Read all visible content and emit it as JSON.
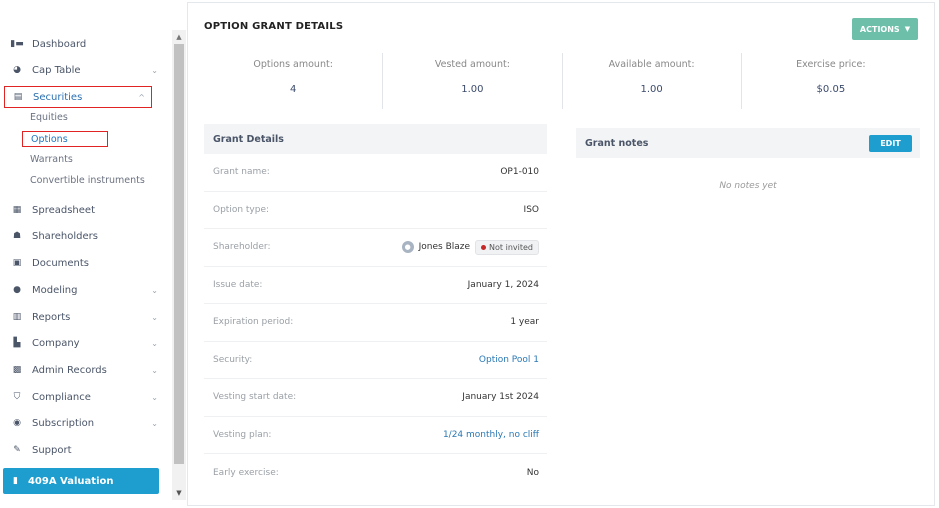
{
  "sidebar": {
    "items": [
      {
        "label": "Dashboard",
        "icon": "dashboard-icon",
        "chevron": ""
      },
      {
        "label": "Cap Table",
        "icon": "pie-chart-icon",
        "chevron": "⌄"
      },
      {
        "label": "Securities",
        "icon": "clipboard-icon",
        "chevron": "^"
      },
      {
        "label": "Spreadsheet",
        "icon": "spreadsheet-icon",
        "chevron": ""
      },
      {
        "label": "Shareholders",
        "icon": "person-icon",
        "chevron": ""
      },
      {
        "label": "Documents",
        "icon": "document-icon",
        "chevron": ""
      },
      {
        "label": "Modeling",
        "icon": "lightbulb-icon",
        "chevron": "⌄"
      },
      {
        "label": "Reports",
        "icon": "report-icon",
        "chevron": "⌄"
      },
      {
        "label": "Company",
        "icon": "company-icon",
        "chevron": "⌄"
      },
      {
        "label": "Admin Records",
        "icon": "records-icon",
        "chevron": "⌄"
      },
      {
        "label": "Compliance",
        "icon": "shield-icon",
        "chevron": "⌄"
      },
      {
        "label": "Subscription",
        "icon": "dollar-icon",
        "chevron": "⌄"
      },
      {
        "label": "Support",
        "icon": "support-icon",
        "chevron": ""
      }
    ],
    "securities_sub": [
      "Equities",
      "Options",
      "Warrants",
      "Convertible instruments"
    ],
    "valuation_button": "409A Valuation"
  },
  "main": {
    "title": "OPTION GRANT DETAILS",
    "actions_label": "ACTIONS",
    "stats": [
      {
        "label": "Options amount:",
        "value": "4"
      },
      {
        "label": "Vested amount:",
        "value": "1.00"
      },
      {
        "label": "Available amount:",
        "value": "1.00"
      },
      {
        "label": "Exercise price:",
        "value": "$0.05"
      }
    ],
    "grant_details": {
      "header": "Grant Details",
      "rows": [
        {
          "label": "Grant name:",
          "value": "OP1-010"
        },
        {
          "label": "Option type:",
          "value": "ISO"
        },
        {
          "label": "Shareholder:",
          "value": "Jones Blaze",
          "badge": "Not invited"
        },
        {
          "label": "Issue date:",
          "value": "January 1, 2024"
        },
        {
          "label": "Expiration period:",
          "value": "1 year"
        },
        {
          "label": "Security:",
          "value": "Option Pool 1"
        },
        {
          "label": "Vesting start date:",
          "value": "January 1st 2024"
        },
        {
          "label": "Vesting plan:",
          "value": "1/24 monthly, no cliff"
        },
        {
          "label": "Early exercise:",
          "value": "No"
        }
      ]
    },
    "grant_notes": {
      "header": "Grant notes",
      "edit_label": "EDIT",
      "empty_text": "No notes yet"
    }
  },
  "colors": {
    "accent": "#1e9dcf",
    "actions_button": "#6dbfa9",
    "highlight_box": "#e02424",
    "link": "#2a78b5"
  }
}
